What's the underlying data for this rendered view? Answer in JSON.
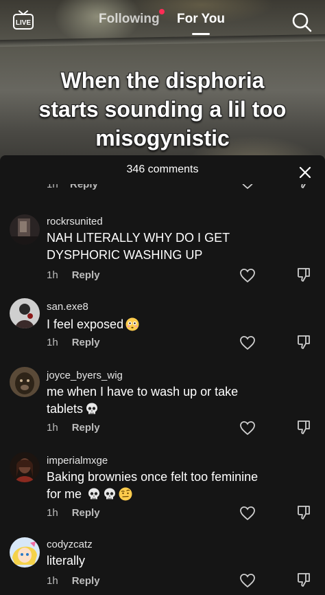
{
  "top_nav": {
    "live_label": "LIVE",
    "following_label": "Following",
    "for_you_label": "For You"
  },
  "video": {
    "caption_lines": [
      "When the disphoria",
      "starts sounding a lil too",
      "misogynistic"
    ]
  },
  "comments_sheet": {
    "title": "346 comments",
    "partial_row": {
      "time": "1h",
      "reply_label": "Reply"
    },
    "comments": [
      {
        "username": "rockrsunited",
        "text_lines": [
          "NAH LITERALLY WHY DO I GET",
          "DYSPHORIC WASHING UP"
        ],
        "time": "1h",
        "reply_label": "Reply",
        "emojis": []
      },
      {
        "username": "san.exe8",
        "text_lines": [
          "I feel exposed"
        ],
        "time": "1h",
        "reply_label": "Reply",
        "emojis": [
          "flushed-face"
        ]
      },
      {
        "username": "joyce_byers_wig",
        "text_lines": [
          "me when I have to wash up or take",
          "tablets"
        ],
        "time": "1h",
        "reply_label": "Reply",
        "emojis": [
          "skull"
        ]
      },
      {
        "username": "imperialmxge",
        "text_lines": [
          "Baking brownies once felt too feminine",
          "for me"
        ],
        "time": "1h",
        "reply_label": "Reply",
        "emojis": [
          "skull",
          "skull",
          "face-with-raised-eyebrow"
        ]
      },
      {
        "username": "codyzcatz",
        "text_lines": [
          "literally"
        ],
        "time": "1h",
        "reply_label": "Reply",
        "emojis": []
      }
    ]
  },
  "colors": {
    "accent": "#fe2c55",
    "sheet_background": "#151515",
    "muted_text": "#bdbdbd"
  }
}
